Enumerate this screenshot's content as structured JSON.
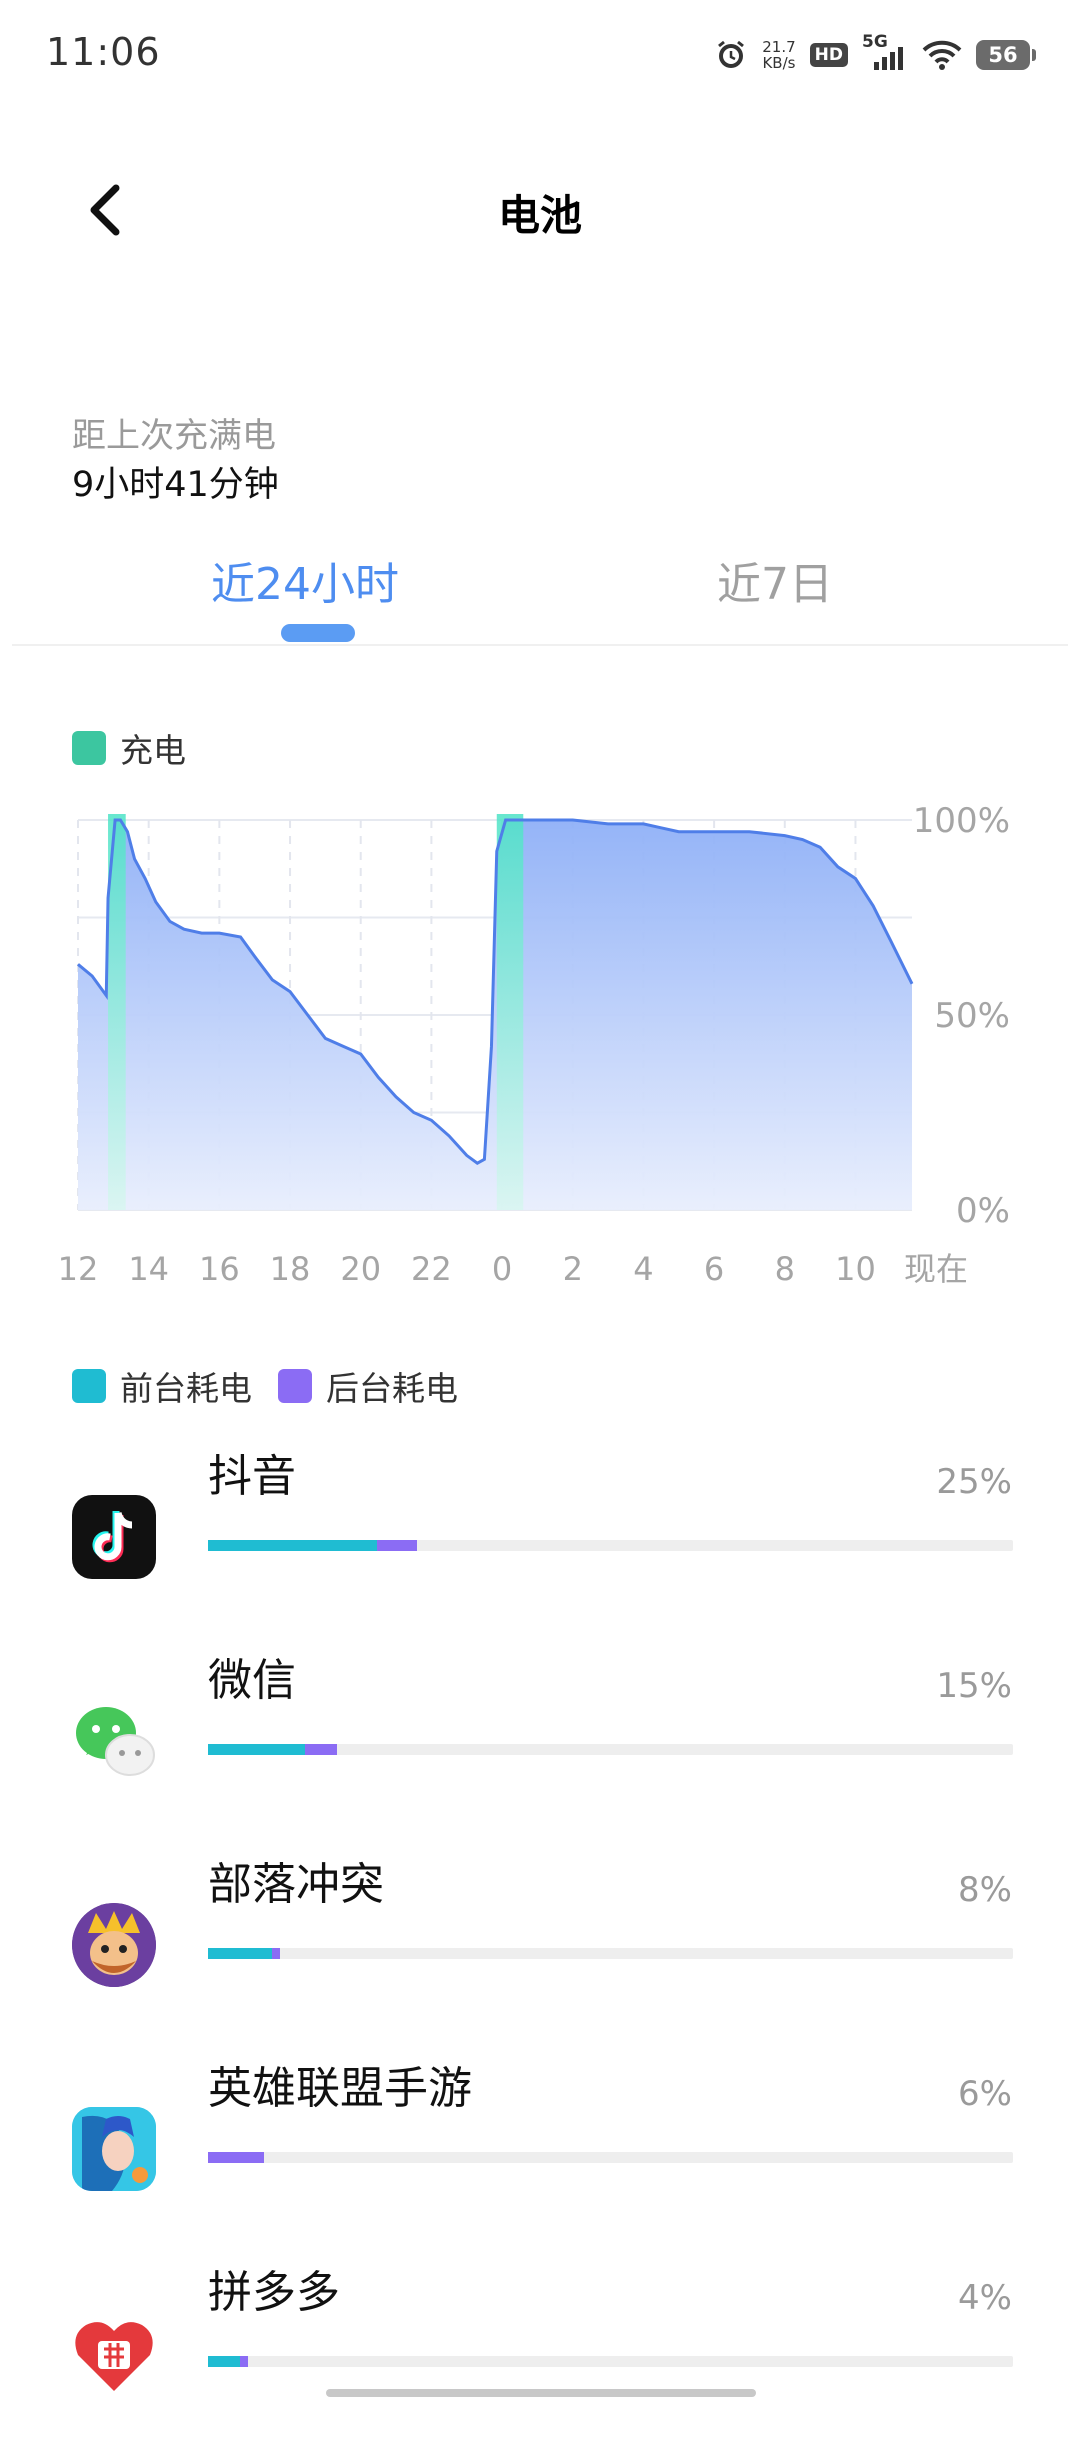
{
  "status_bar": {
    "time": "11:06",
    "network_speed_value": "21.7",
    "network_speed_unit": "KB/s",
    "hd_badge": "HD",
    "network_type": "5G",
    "battery_level": "56"
  },
  "header": {
    "title": "电池"
  },
  "since_full_charge": {
    "label": "距上次充满电",
    "value": "9小时41分钟"
  },
  "tabs": [
    {
      "label": "近24小时",
      "active": true
    },
    {
      "label": "近7日",
      "active": false
    }
  ],
  "chart_legend": {
    "charge_label": "充电",
    "charge_color": "#3cc6a0"
  },
  "chart_data": {
    "type": "area",
    "title": "",
    "x_tick_labels": [
      "12",
      "14",
      "16",
      "18",
      "20",
      "22",
      "0",
      "2",
      "4",
      "6",
      "8",
      "10",
      "现在"
    ],
    "y_tick_labels": [
      "100%",
      "50%",
      "0%"
    ],
    "ylim": [
      0,
      100
    ],
    "x_unit": "hours since 11:30 yesterday",
    "xlim": [
      0,
      23.6
    ],
    "grid": true,
    "series": [
      {
        "name": "battery",
        "x": [
          0,
          0.4,
          0.8,
          0.85,
          1.05,
          1.2,
          1.4,
          1.6,
          1.9,
          2.2,
          2.6,
          3.0,
          3.5,
          4.0,
          4.6,
          5.0,
          5.5,
          6.0,
          6.5,
          7.0,
          7.5,
          8.0,
          8.5,
          9.0,
          9.5,
          10.0,
          10.5,
          11.0,
          11.3,
          11.5,
          11.7,
          11.85,
          12.1,
          12.3,
          12.6,
          13.0,
          14.0,
          15.0,
          16.0,
          16.5,
          17.0,
          18.0,
          19.0,
          20.0,
          20.5,
          21.0,
          21.5,
          22.0,
          22.5,
          23.0,
          23.6
        ],
        "y": [
          63,
          60,
          55,
          80,
          100,
          100,
          97,
          90,
          85,
          79,
          74,
          72,
          71,
          71,
          70,
          65,
          59,
          56,
          50,
          44,
          42,
          40,
          34,
          29,
          25,
          23,
          19,
          14,
          12,
          13,
          42,
          92,
          100,
          100,
          100,
          100,
          100,
          99,
          99,
          98,
          97,
          97,
          97,
          96,
          95,
          93,
          88,
          85,
          78,
          69,
          58
        ]
      }
    ],
    "charging_periods": [
      {
        "start": 0.85,
        "end": 1.35
      },
      {
        "start": 11.85,
        "end": 12.6
      }
    ]
  },
  "usage_legend": {
    "foreground_label": "前台耗电",
    "background_label": "后台耗电",
    "foreground_color": "#1fbcd2",
    "background_color": "#8b6cf4"
  },
  "apps": [
    {
      "name": "抖音",
      "percent": "25%",
      "icon": "douyin-icon",
      "foreground_fraction": 0.21,
      "background_fraction": 0.05
    },
    {
      "name": "微信",
      "percent": "15%",
      "icon": "wechat-icon",
      "foreground_fraction": 0.12,
      "background_fraction": 0.04
    },
    {
      "name": "部落冲突",
      "percent": "8%",
      "icon": "clash-of-clans-icon",
      "foreground_fraction": 0.08,
      "background_fraction": 0.01
    },
    {
      "name": "英雄联盟手游",
      "percent": "6%",
      "icon": "league-of-legends-wild-rift-icon",
      "foreground_fraction": 0.0,
      "background_fraction": 0.07
    },
    {
      "name": "拼多多",
      "percent": "4%",
      "icon": "pinduoduo-icon",
      "foreground_fraction": 0.04,
      "background_fraction": 0.01
    }
  ]
}
